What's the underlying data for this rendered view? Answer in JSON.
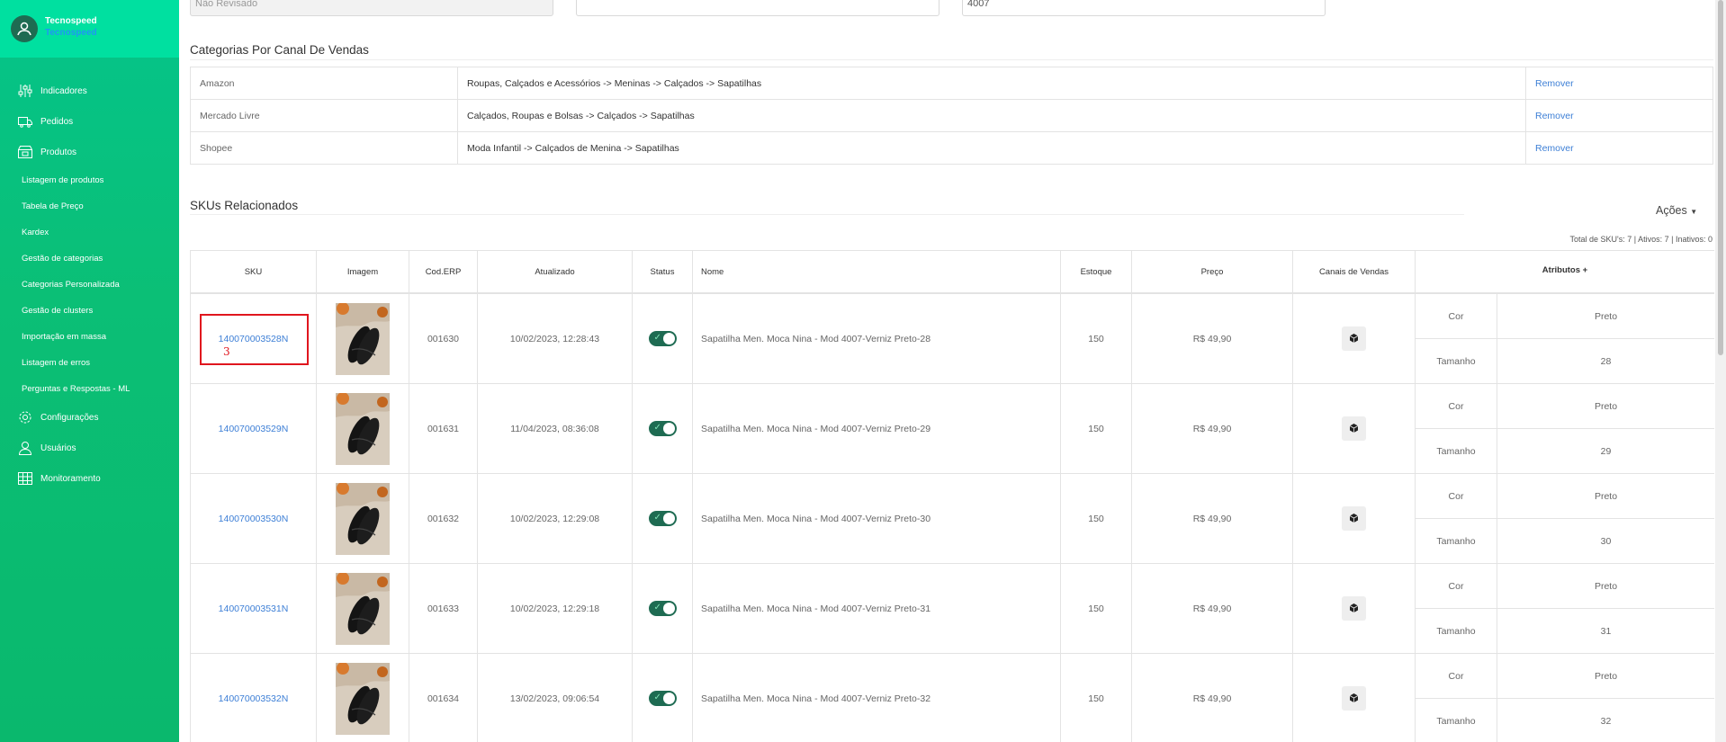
{
  "sidebar": {
    "company": "Tecnospeed",
    "company_sub": "Tecnospeed",
    "items": [
      {
        "label": "Indicadores",
        "icon": "sliders-icon"
      },
      {
        "label": "Pedidos",
        "icon": "truck-icon"
      },
      {
        "label": "Produtos",
        "icon": "products-icon"
      }
    ],
    "subitems": [
      "Listagem de produtos",
      "Tabela de Preço",
      "Kardex",
      "Gestão de categorias",
      "Categorias Personalizada",
      "Gestão de clusters",
      "Importação em massa",
      "Listagem de erros",
      "Perguntas e Respostas - ML"
    ],
    "items_bottom": [
      {
        "label": "Configurações",
        "icon": "gear-icon"
      },
      {
        "label": "Usuários",
        "icon": "user-icon"
      },
      {
        "label": "Monitoramento",
        "icon": "grid-icon"
      }
    ]
  },
  "top_fields": {
    "field1": "Não Revisado",
    "field2": "",
    "field3": "4007"
  },
  "categories": {
    "title": "Categorias Por Canal De Vendas",
    "rows": [
      {
        "channel": "Amazon",
        "path": "Roupas, Calçados e Acessórios -> Meninas -> Calçados -> Sapatilhas",
        "action": "Remover"
      },
      {
        "channel": "Mercado Livre",
        "path": "Calçados, Roupas e Bolsas -> Calçados -> Sapatilhas",
        "action": "Remover"
      },
      {
        "channel": "Shopee",
        "path": "Moda Infantil -> Calçados de Menina -> Sapatilhas",
        "action": "Remover"
      }
    ]
  },
  "skus": {
    "title": "SKUs Relacionados",
    "actions_label": "Ações",
    "totals": "Total de SKU's: 7 | Ativos: 7 | Inativos: 0",
    "headers": {
      "sku": "SKU",
      "imagem": "Imagem",
      "cod_erp": "Cod.ERP",
      "atualizado": "Atualizado",
      "status": "Status",
      "nome": "Nome",
      "estoque": "Estoque",
      "preco": "Preço",
      "canais": "Canais de Vendas",
      "atributos": "Atributos +"
    },
    "attr_labels": {
      "cor": "Cor",
      "tamanho": "Tamanho"
    },
    "rows": [
      {
        "sku": "140070003528N",
        "erp": "001630",
        "updated": "10/02/2023, 12:28:43",
        "nome": "Sapatilha Men. Moca Nina - Mod 4007-Verniz Preto-28",
        "estoque": "150",
        "preco": "R$ 49,90",
        "cor": "Preto",
        "tamanho": "28"
      },
      {
        "sku": "140070003529N",
        "erp": "001631",
        "updated": "11/04/2023, 08:36:08",
        "nome": "Sapatilha Men. Moca Nina - Mod 4007-Verniz Preto-29",
        "estoque": "150",
        "preco": "R$ 49,90",
        "cor": "Preto",
        "tamanho": "29"
      },
      {
        "sku": "140070003530N",
        "erp": "001632",
        "updated": "10/02/2023, 12:29:08",
        "nome": "Sapatilha Men. Moca Nina - Mod 4007-Verniz Preto-30",
        "estoque": "150",
        "preco": "R$ 49,90",
        "cor": "Preto",
        "tamanho": "30"
      },
      {
        "sku": "140070003531N",
        "erp": "001633",
        "updated": "10/02/2023, 12:29:18",
        "nome": "Sapatilha Men. Moca Nina - Mod 4007-Verniz Preto-31",
        "estoque": "150",
        "preco": "R$ 49,90",
        "cor": "Preto",
        "tamanho": "31"
      },
      {
        "sku": "140070003532N",
        "erp": "001634",
        "updated": "13/02/2023, 09:06:54",
        "nome": "Sapatilha Men. Moca Nina - Mod 4007-Verniz Preto-32",
        "estoque": "150",
        "preco": "R$ 49,90",
        "cor": "Preto",
        "tamanho": "32"
      }
    ]
  },
  "annotation": {
    "number": "3"
  }
}
